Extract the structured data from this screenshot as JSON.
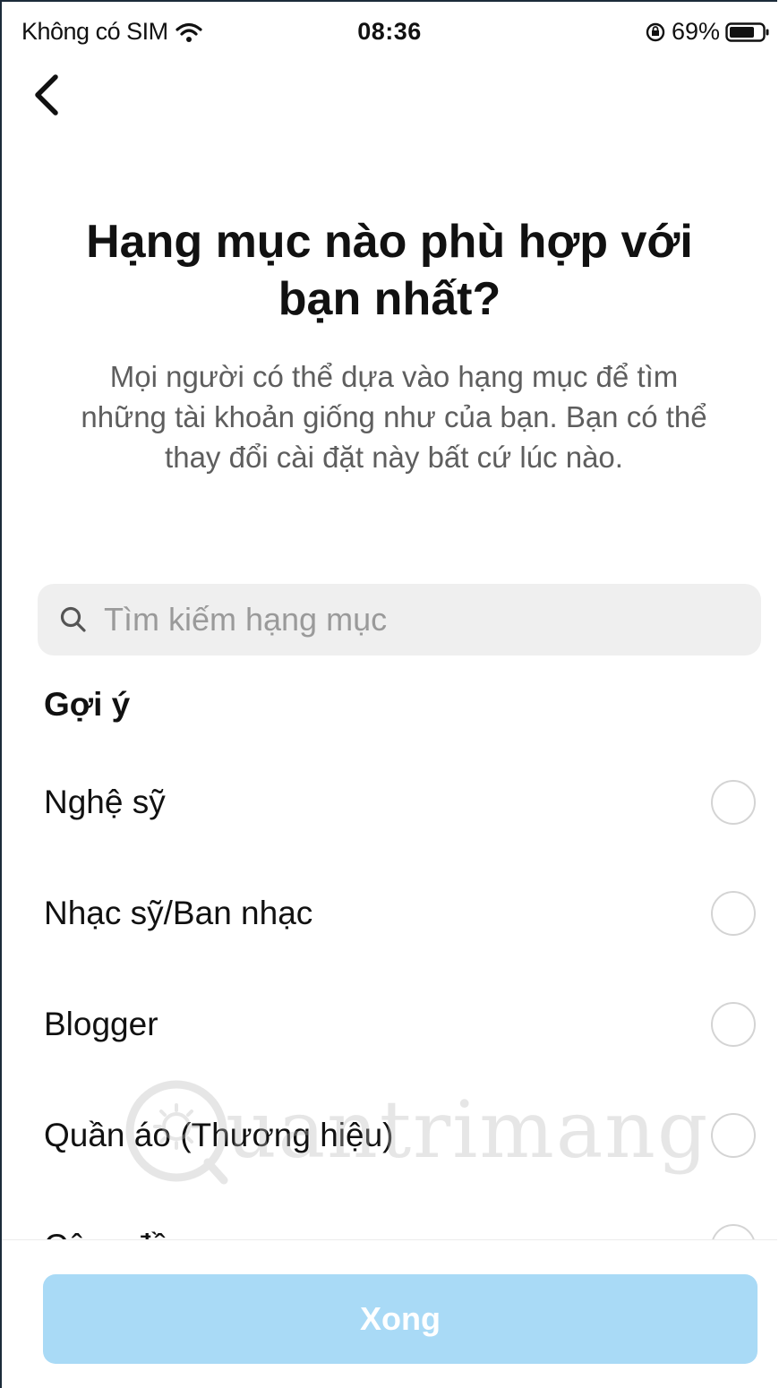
{
  "status_bar": {
    "carrier": "Không có SIM",
    "time": "08:36",
    "battery": "69%",
    "icons": [
      "wifi-icon",
      "lock-rotation-icon",
      "battery-icon"
    ]
  },
  "header": {
    "back_icon": "chevron-left-icon"
  },
  "title": "Hạng mục nào phù hợp với bạn nhất?",
  "subtitle": "Mọi người có thể dựa vào hạng mục để tìm những tài khoản giống như của bạn. Bạn có thể thay đổi cài đặt này bất cứ lúc nào.",
  "search": {
    "placeholder": "Tìm kiếm hạng mục",
    "value": ""
  },
  "suggestions": {
    "heading": "Gợi ý",
    "items": [
      {
        "label": "Nghệ sỹ",
        "selected": false
      },
      {
        "label": "Nhạc sỹ/Ban nhạc",
        "selected": false
      },
      {
        "label": "Blogger",
        "selected": false
      },
      {
        "label": "Quần áo (Thương hiệu)",
        "selected": false
      },
      {
        "label": "Cộng đồng",
        "selected": false
      }
    ]
  },
  "watermark": "uantrimang",
  "footer": {
    "done_label": "Xong"
  },
  "colors": {
    "done_button": "#a9daf6",
    "search_bg": "#efefef",
    "radio_border": "#d4d4d4"
  }
}
